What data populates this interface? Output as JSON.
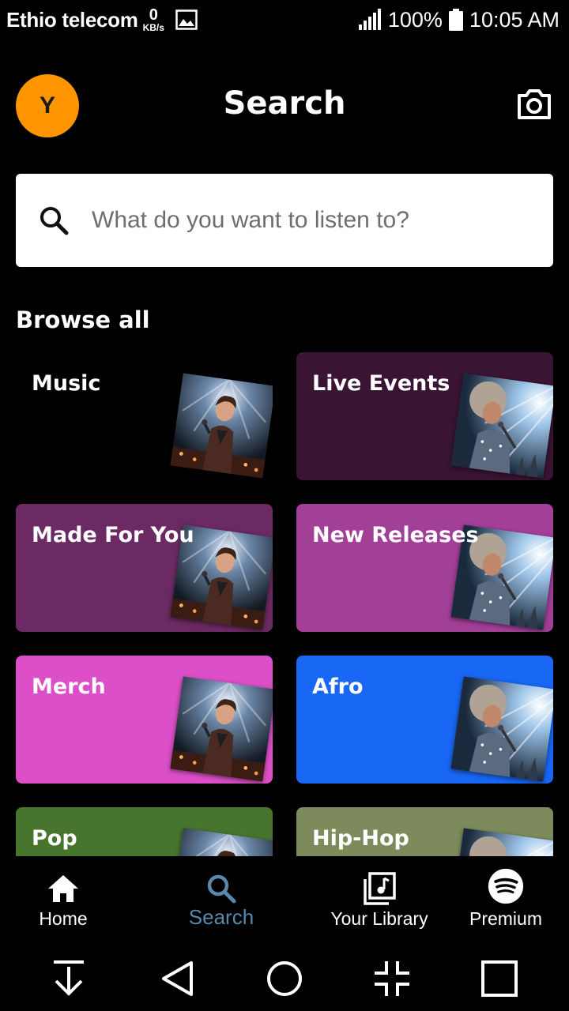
{
  "status_bar": {
    "carrier": "Ethio telecom",
    "speed_value": "0",
    "speed_unit": "KB/s",
    "battery": "100%",
    "time": "10:05 AM"
  },
  "header": {
    "avatar_initial": "Y",
    "title": "Search",
    "camera_icon": "camera-icon"
  },
  "search": {
    "placeholder": "What do you want to listen to?",
    "value": ""
  },
  "browse": {
    "title": "Browse all",
    "tiles": [
      {
        "label": "Music",
        "color": "#000000",
        "art": "male-singer"
      },
      {
        "label": "Live Events",
        "color": "#3a1433",
        "art": "female-singer"
      },
      {
        "label": "Made For You",
        "color": "#6b2a63",
        "art": "male-singer"
      },
      {
        "label": "New Releases",
        "color": "#a23f97",
        "art": "female-singer"
      },
      {
        "label": "Merch",
        "color": "#dc4fc8",
        "art": "male-singer"
      },
      {
        "label": "Afro",
        "color": "#1867f5",
        "art": "female-singer"
      },
      {
        "label": "Pop",
        "color": "#47752e",
        "art": "male-singer"
      },
      {
        "label": "Hip-Hop",
        "color": "#7d8b5c",
        "art": "female-singer"
      }
    ]
  },
  "bottom_nav": {
    "items": [
      {
        "label": "Home",
        "icon": "home-icon"
      },
      {
        "label": "Search",
        "icon": "search-icon",
        "active": true
      },
      {
        "label": "Your Library",
        "icon": "library-icon"
      },
      {
        "label": "Premium",
        "icon": "spotify-icon"
      }
    ]
  },
  "system_nav": [
    "download-icon",
    "back-icon",
    "home-circle-icon",
    "collapse-icon",
    "recents-icon"
  ]
}
